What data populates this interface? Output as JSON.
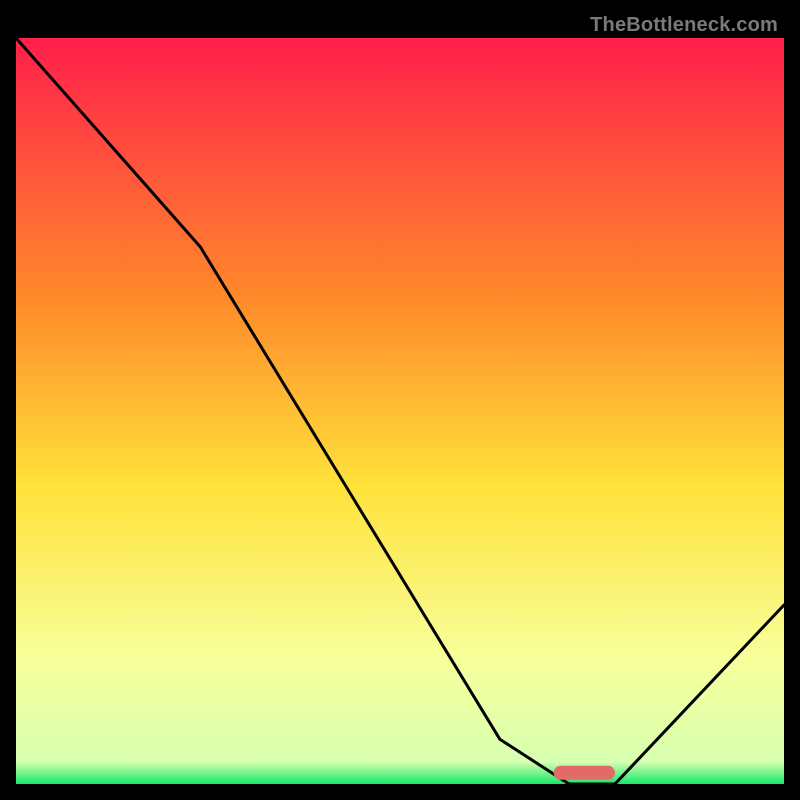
{
  "watermark": "TheBottleneck.com",
  "colors": {
    "top": "#ff1f4b",
    "mid_upper": "#ff8a2a",
    "mid": "#ffe23a",
    "lower": "#f8ff9a",
    "bottom": "#17e86a",
    "curve": "#000000",
    "marker": "#e46a6a",
    "frame_bg": "#000000"
  },
  "chart_data": {
    "type": "line",
    "title": "",
    "xlabel": "",
    "ylabel": "",
    "xlim": [
      0,
      100
    ],
    "ylim": [
      0,
      100
    ],
    "x": [
      0,
      24,
      63,
      72,
      78,
      100
    ],
    "values": [
      100,
      72,
      6,
      0,
      0,
      24
    ],
    "marker": {
      "x_start": 70,
      "x_end": 78,
      "y": 1.5
    },
    "annotations": []
  }
}
